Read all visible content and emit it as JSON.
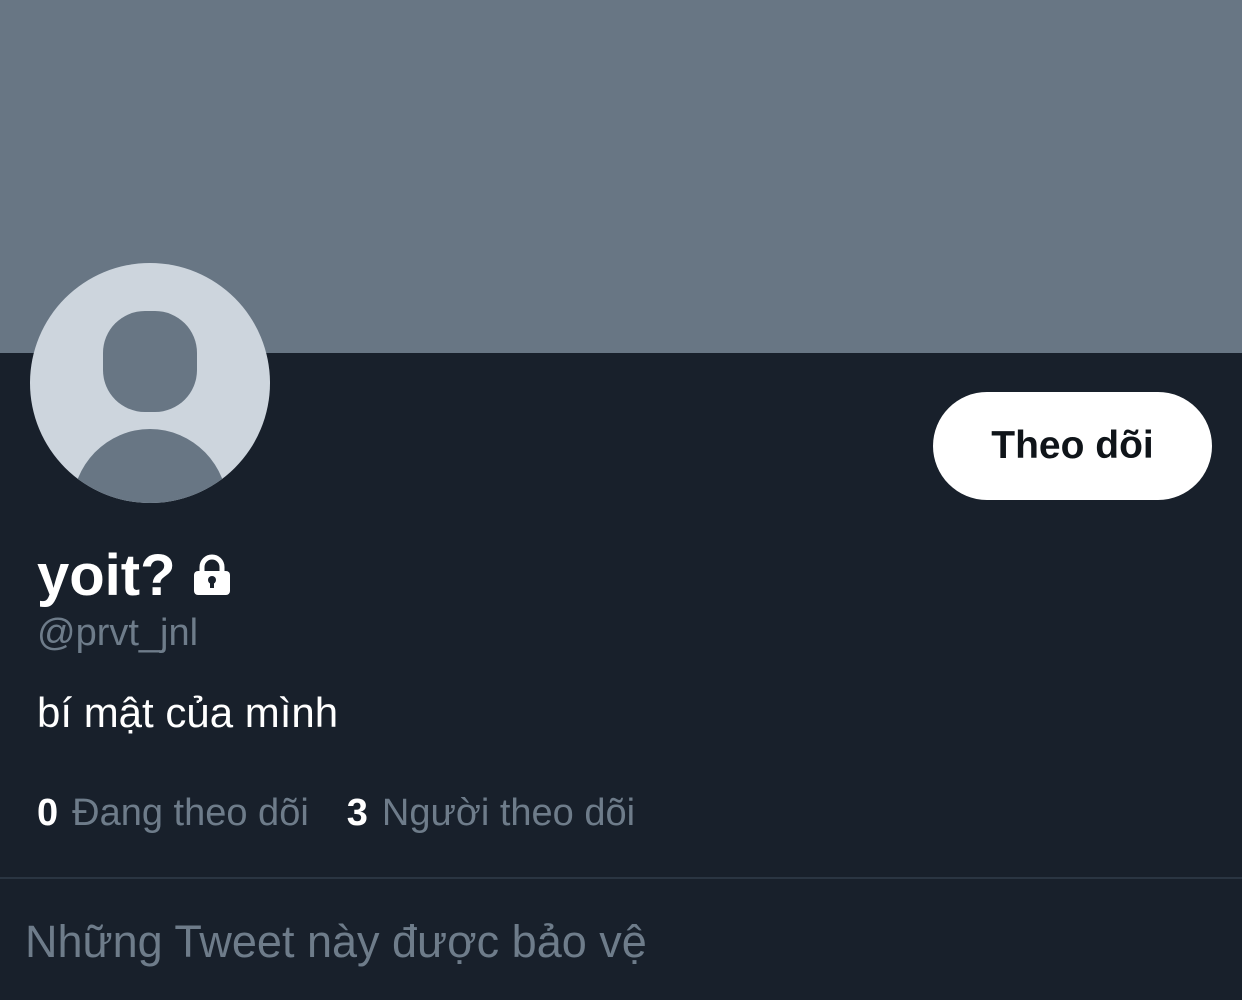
{
  "profile": {
    "display_name": "yoit?",
    "handle": "@prvt_jnl",
    "bio": "bí mật của mình",
    "locked_icon": "lock-icon",
    "follow_button_label": "Theo dõi"
  },
  "stats": {
    "following_count": "0",
    "following_label": "Đang theo dõi",
    "followers_count": "3",
    "followers_label": "Người theo dõi"
  },
  "protected_message": "Những Tweet này được bảo vệ",
  "colors": {
    "banner": "#687684",
    "background": "#18202b",
    "avatar_bg": "#cdd5dd",
    "muted_text": "#6e7c8a",
    "button_bg": "#ffffff"
  }
}
